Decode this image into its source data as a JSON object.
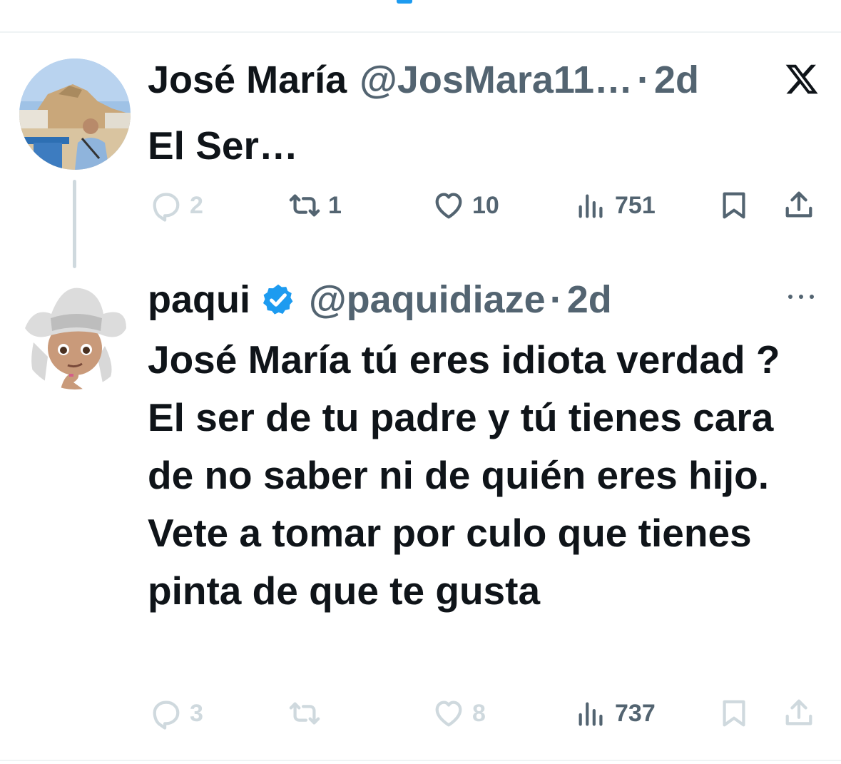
{
  "colors": {
    "accent": "#1d9bf0",
    "text": "#0f1419",
    "secondary": "#536471",
    "muted": "#cfd9de"
  },
  "tweets": [
    {
      "name": "José María",
      "handle": "@JosMara11…",
      "separator": "·",
      "time": "2d",
      "text": "El Ser…",
      "corner_icon": "x-logo-icon",
      "actions": {
        "replies": "2",
        "retweets": "1",
        "likes": "10",
        "views": "751"
      }
    },
    {
      "name": "paqui",
      "verified": true,
      "handle": "@paquidiaze",
      "separator": "·",
      "time": "2d",
      "text": "José María tú eres idiota verdad ? El ser de tu padre y tú tienes cara de no saber ni de quién eres hijo. Vete a tomar por culo que tienes pinta de que te gusta",
      "corner_icon": "more-options-icon",
      "actions": {
        "replies": "3",
        "retweets": "",
        "likes": "8",
        "views": "737"
      }
    }
  ]
}
